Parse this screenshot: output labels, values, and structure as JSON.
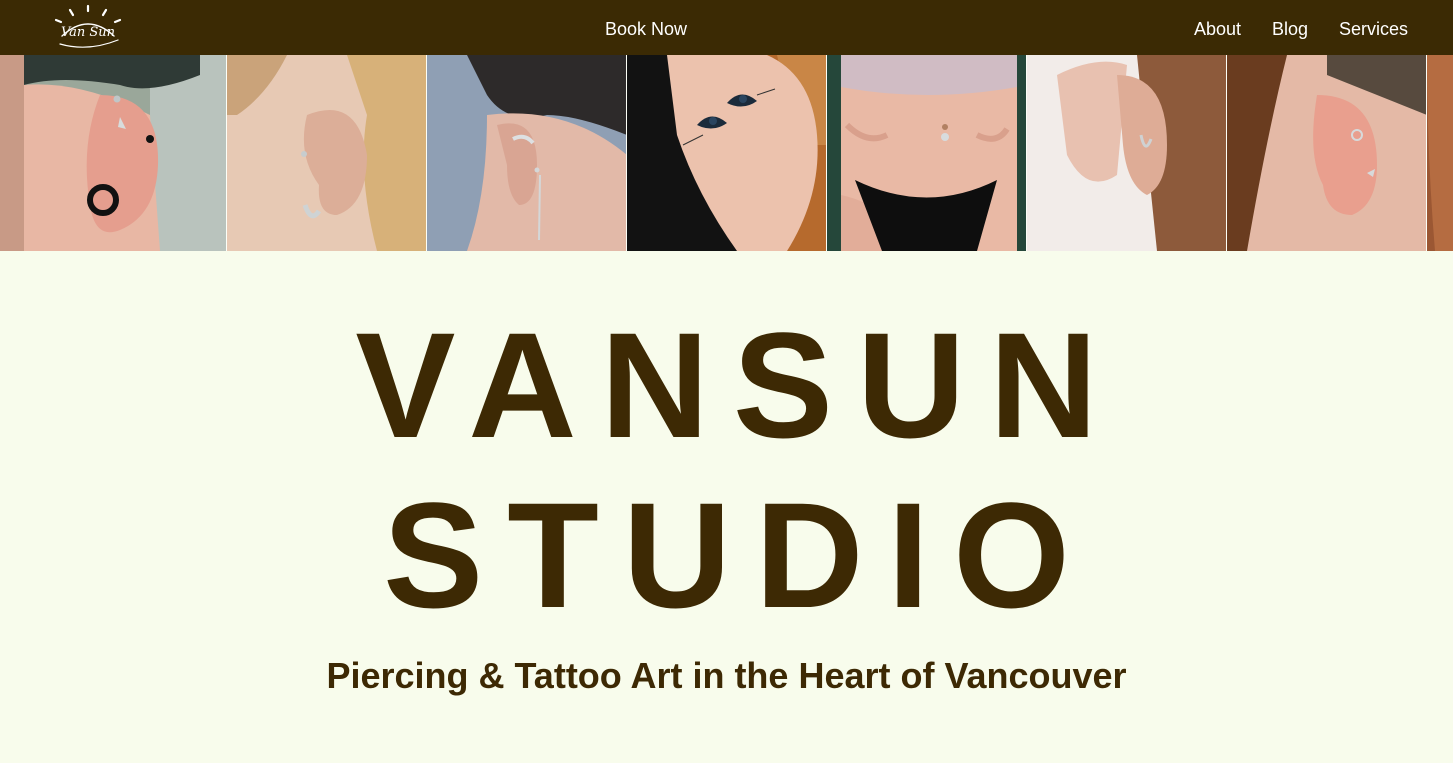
{
  "nav": {
    "logo_text": "Van Sun",
    "book_label": "Book Now",
    "about_label": "About",
    "blog_label": "Blog",
    "services_label": "Services"
  },
  "gallery": {
    "photos": [
      {
        "subject": "ear-piercings-with-tunnel"
      },
      {
        "subject": "ear-hoop-piercing"
      },
      {
        "subject": "ear-cuff-piercings"
      },
      {
        "subject": "shoulder-eyes-tattoo"
      },
      {
        "subject": "navel-piercing"
      },
      {
        "subject": "ear-lobe-hoop"
      },
      {
        "subject": "ear-daith-piercings"
      }
    ]
  },
  "hero": {
    "title_line1": "VANSUN",
    "title_line2": "STUDIO",
    "tagline": "Piercing & Tattoo Art in the Heart of Vancouver"
  },
  "colors": {
    "brand_brown": "#3b2a04",
    "background": "#f8fcec"
  }
}
